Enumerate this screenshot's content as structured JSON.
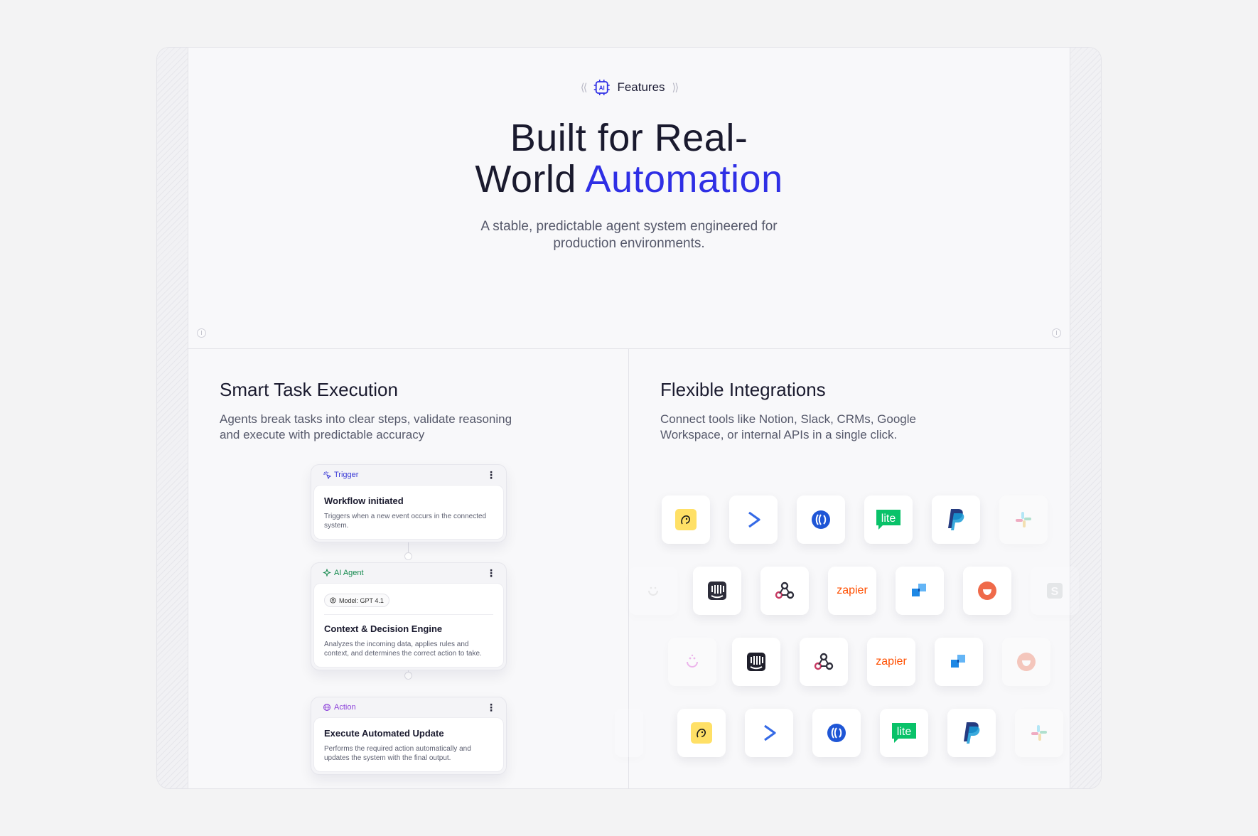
{
  "hero": {
    "badge_label": "Features",
    "title_line1": "Built for Real-",
    "title_line2_plain": "World",
    "title_line2_accent": "Automation",
    "subtitle": "A stable, predictable agent system engineered for production environments."
  },
  "smart_task": {
    "title": "Smart Task Execution",
    "description": "Agents break tasks into clear steps, validate reasoning and execute with predictable accuracy",
    "cards": [
      {
        "tag": "Trigger",
        "title": "Workflow initiated",
        "description": "Triggers when a new event occurs in the connected system."
      },
      {
        "tag": "AI Agent",
        "model": "Model: GPT 4.1",
        "title": "Context & Decision Engine",
        "description": "Analyzes the incoming data, applies rules and context, and determines the correct action to take."
      },
      {
        "tag": "Action",
        "title": "Execute Automated Update",
        "description": "Performs the required action automatically and updates the system with the final output."
      }
    ]
  },
  "integrations": {
    "title": "Flexible Integrations",
    "description": "Connect tools like Notion, Slack, CRMs, Google Workspace, or internal APIs in a single click.",
    "rows": [
      [
        "mailchimp-icon",
        "activecampaign-icon",
        "airtable-icon",
        "mailerlite-icon",
        "paypal-icon",
        "slack-icon"
      ],
      [
        "smile-icon",
        "intercom-icon",
        "webhook-icon",
        "zapier-icon",
        "squares-icon",
        "smile-orange-icon",
        "s-icon"
      ],
      [
        "smile-icon",
        "intercom-icon",
        "webhook-icon",
        "zapier-icon",
        "squares-icon",
        "smile-orange-icon"
      ],
      [
        "mailchimp-icon",
        "activecampaign-icon",
        "airtable-icon",
        "mailerlite-icon",
        "paypal-icon",
        "slack-icon"
      ]
    ],
    "mailerlite_text": "lite",
    "zapier_text": "zapier"
  },
  "colors": {
    "accent": "#2f2fe5",
    "trigger": "#3a3ad6",
    "agent": "#13894d",
    "action": "#8b3fd9"
  }
}
